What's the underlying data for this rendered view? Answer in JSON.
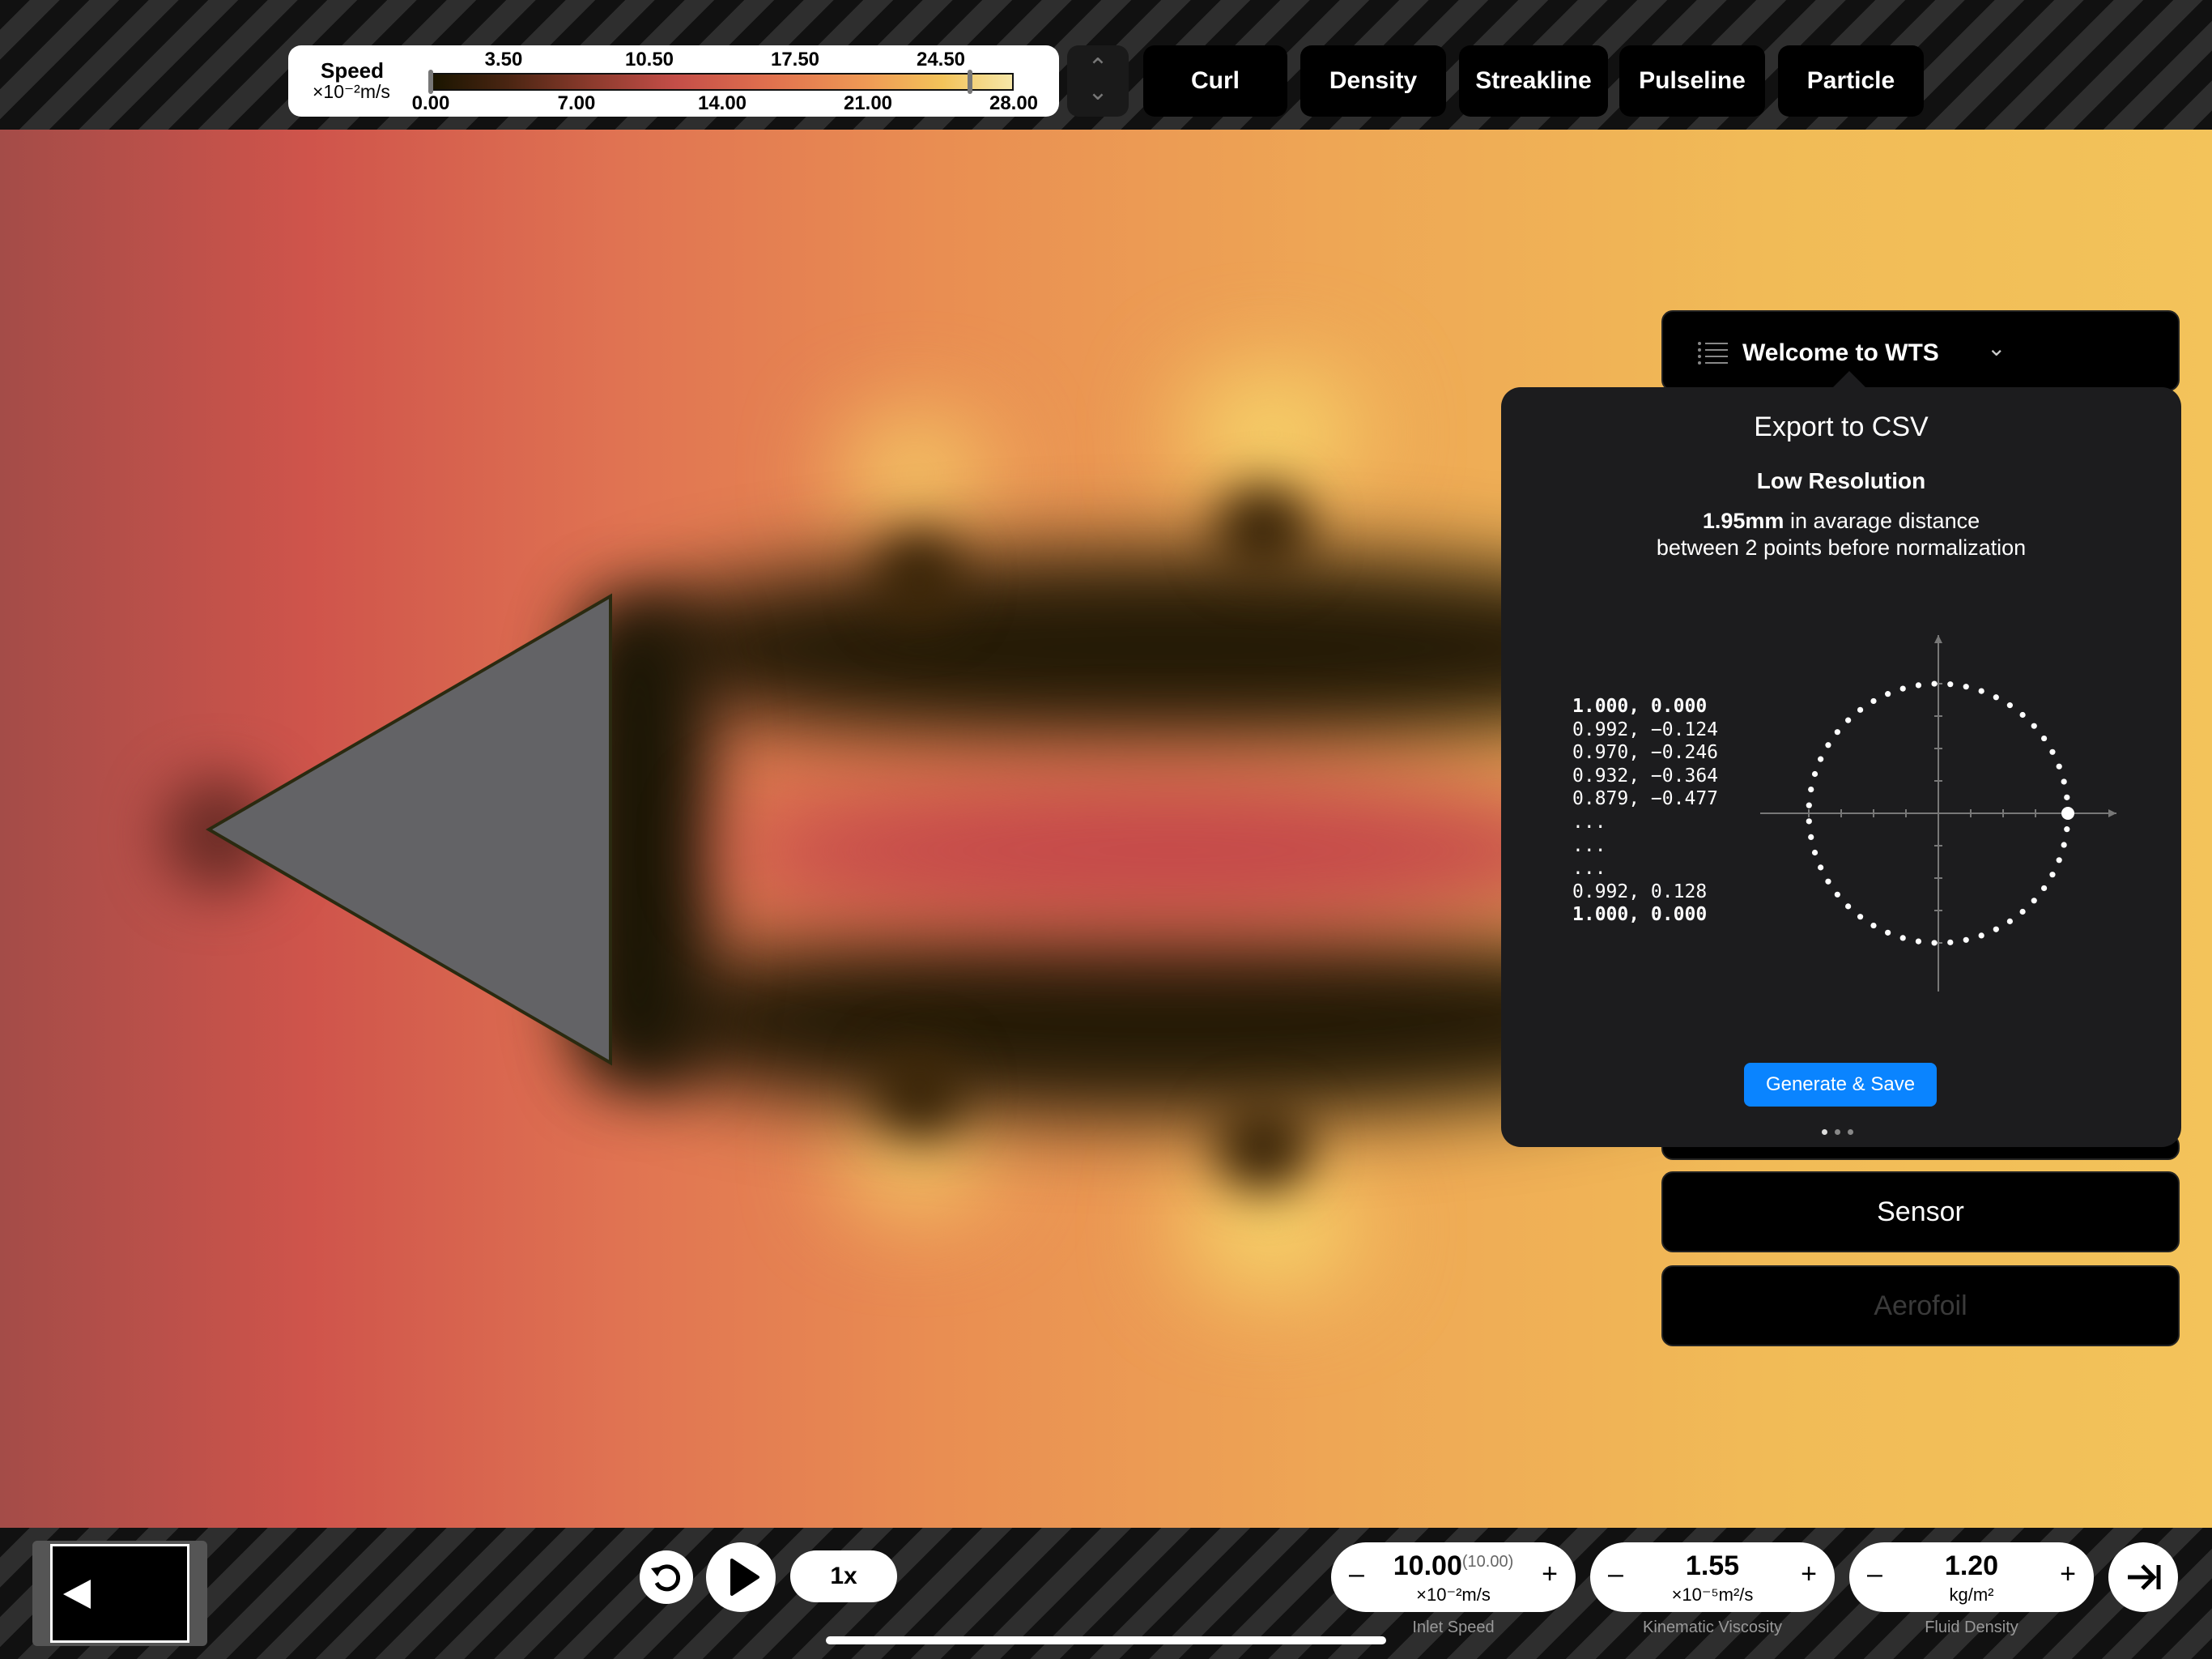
{
  "legend": {
    "title": "Speed",
    "unit": "×10⁻²m/s",
    "ticks_top": [
      "3.50",
      "10.50",
      "17.50",
      "24.50"
    ],
    "ticks_bottom": [
      "0.00",
      "7.00",
      "14.00",
      "21.00",
      "28.00"
    ],
    "range": [
      0,
      28
    ],
    "selected_range": [
      0.0,
      25.9
    ]
  },
  "legend_stepper": {
    "up_icon": "chevron-up-icon",
    "down_icon": "chevron-down-icon",
    "up": "⌃",
    "down": "⌄"
  },
  "modes": [
    "Curl",
    "Density",
    "Streakline",
    "Pulseline",
    "Particle"
  ],
  "panel": {
    "welcome_label": "Welcome to WTS",
    "welcome_icon": "list-icon",
    "chevron": "⌄",
    "sensor_label": "Sensor",
    "aerofoil_label": "Aerofoil"
  },
  "popover": {
    "title": "Export to CSV",
    "subtitle": "Low Resolution",
    "distance_value": "1.95mm",
    "distance_text": " in avarage distance",
    "distance_text2": "between 2 points before normalization",
    "csv_lines": [
      {
        "text": "1.000, 0.000",
        "bold": true
      },
      {
        "text": "0.992, −0.124",
        "bold": false
      },
      {
        "text": "0.970, −0.246",
        "bold": false
      },
      {
        "text": "0.932, −0.364",
        "bold": false
      },
      {
        "text": "0.879, −0.477",
        "bold": false
      },
      {
        "text": "...",
        "bold": false
      },
      {
        "text": "...",
        "bold": false
      },
      {
        "text": "...",
        "bold": false
      },
      {
        "text": "0.992, 0.128",
        "bold": false
      },
      {
        "text": "1.000, 0.000",
        "bold": true
      }
    ],
    "point_count": 51,
    "button_label": "Generate & Save",
    "page_dots": 3,
    "active_dot": 0
  },
  "controls": {
    "reset_icon": "reset-icon",
    "play_icon": "play-icon",
    "speed_label": "1x",
    "collapse_icon": "arrow-to-right-icon",
    "minimap_icon": "triangle-left-icon"
  },
  "params": [
    {
      "value": "10.00",
      "sub": "(10.00)",
      "unit": "×10⁻²m/s",
      "label": "Inlet Speed",
      "minus": "–",
      "plus": "+"
    },
    {
      "value": "1.55",
      "sub": "",
      "unit": "×10⁻⁵m²/s",
      "label": "Kinematic Viscosity",
      "minus": "–",
      "plus": "+"
    },
    {
      "value": "1.20",
      "sub": "",
      "unit": "kg/m²",
      "label": "Fluid Density",
      "minus": "–",
      "plus": "+"
    }
  ],
  "colors": {
    "accent": "#0a84ff",
    "shape": "#636366",
    "popover_bg": "#1c1c1e"
  }
}
